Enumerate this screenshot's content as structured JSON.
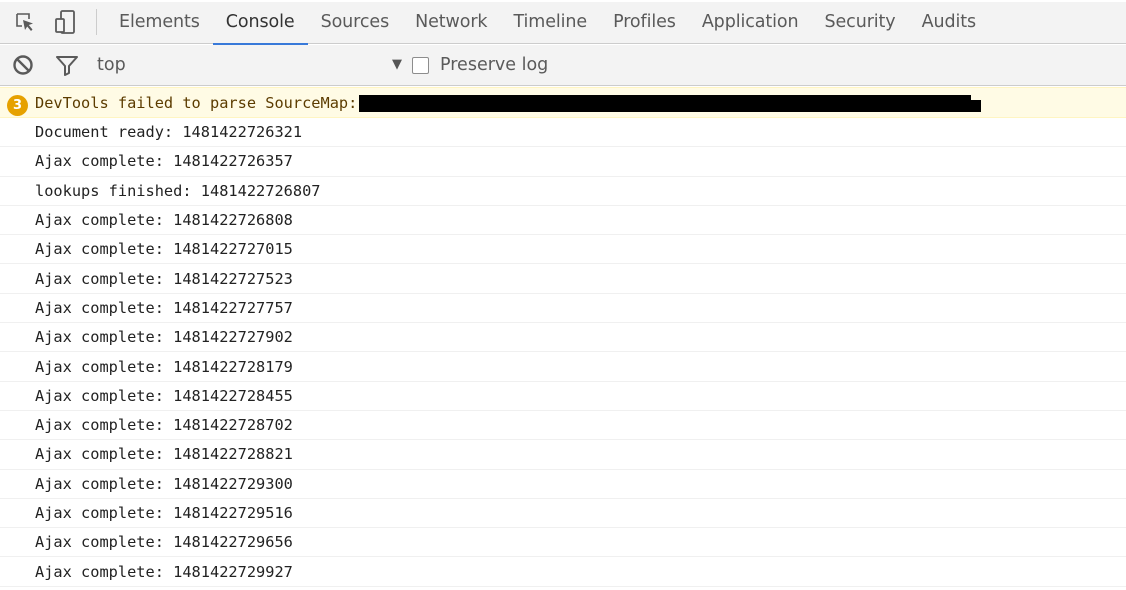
{
  "tabs": [
    "Elements",
    "Console",
    "Sources",
    "Network",
    "Timeline",
    "Profiles",
    "Application",
    "Security",
    "Audits"
  ],
  "active_tab": "Console",
  "toolbar": {
    "context": "top",
    "preserve_log_label": "Preserve log",
    "preserve_log_checked": false
  },
  "warning": {
    "count": "3",
    "text": "DevTools failed to parse SourceMap:"
  },
  "messages": [
    "Document ready: 1481422726321",
    "Ajax complete: 1481422726357",
    "lookups finished: 1481422726807",
    "Ajax complete: 1481422726808",
    "Ajax complete: 1481422727015",
    "Ajax complete: 1481422727523",
    "Ajax complete: 1481422727757",
    "Ajax complete: 1481422727902",
    "Ajax complete: 1481422728179",
    "Ajax complete: 1481422728455",
    "Ajax complete: 1481422728702",
    "Ajax complete: 1481422728821",
    "Ajax complete: 1481422729300",
    "Ajax complete: 1481422729516",
    "Ajax complete: 1481422729656",
    "Ajax complete: 1481422729927"
  ],
  "colors": {
    "accent": "#3879d9",
    "warning_badge": "#e6a100",
    "warning_bg": "#fffbe5"
  },
  "icons": [
    "inspect-element-icon",
    "device-toolbar-icon",
    "clear-console-icon",
    "filter-icon",
    "dropdown-arrow-icon",
    "warning-count-badge"
  ]
}
